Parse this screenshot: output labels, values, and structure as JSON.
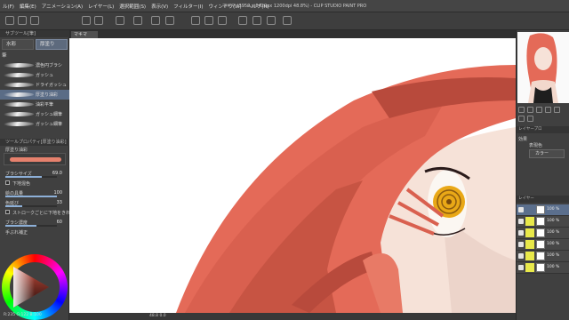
{
  "window": {
    "title": "マキマ (3950 x 6420px 1200dpi 48.8%) - CLIP STUDIO PAINT PRO",
    "menu": [
      "ル(F)",
      "編集(E)",
      "アニメーション(A)",
      "レイヤー(L)",
      "選択範囲(S)",
      "表示(V)",
      "フィルター(I)",
      "ウィンドウ(W)",
      "ヘルプ(H)"
    ]
  },
  "left_panel": {
    "sub_tool_header": "サブツール[筆]",
    "tabs": [
      "水彩",
      "厚塗り"
    ],
    "category": "筆",
    "brushes": [
      {
        "label": "濃色円ブラシ",
        "selected": false
      },
      {
        "label": "ガッシュ",
        "selected": false
      },
      {
        "label": "ドライガッシュ",
        "selected": false
      },
      {
        "label": "厚塗り油彩",
        "selected": true
      },
      {
        "label": "油彩平筆",
        "selected": false
      },
      {
        "label": "ガッシュ細筆",
        "selected": false
      },
      {
        "label": "ガッシュ細筆",
        "selected": false
      }
    ],
    "tool_property_header": "ツールプロパティ[厚塗り油彩]",
    "brush_preview_label": "厚塗り油彩",
    "properties": [
      {
        "label": "ブラシサイズ",
        "value": "69.0",
        "fill": 0.7,
        "type": "slider"
      },
      {
        "label": "下地混色",
        "value": "",
        "type": "check"
      },
      {
        "label": "絵の具量",
        "value": "100",
        "fill": 1.0,
        "type": "slider"
      },
      {
        "label": "色延び",
        "value": "33",
        "fill": 0.33,
        "type": "slider"
      },
      {
        "label": "ストロークごとに下地をきれいにする",
        "value": "",
        "type": "check"
      },
      {
        "label": "ブラシ濃度",
        "value": "60",
        "fill": 0.6,
        "type": "slider"
      },
      {
        "label": "手ぶれ補正",
        "value": "",
        "type": "text"
      }
    ],
    "color_readout": "R:235 G:122 B:100"
  },
  "canvas": {
    "tab_label": "マキマ",
    "status_text": "48.8   0.0"
  },
  "right_panel": {
    "tabs": "ナビゲーター",
    "layer_property_tab": "レイヤープロ",
    "effect_label": "効果",
    "expression_label": "表現色",
    "expression_value": "カラー",
    "layer_header": "レイヤー",
    "layers": [
      {
        "name": "100 %",
        "selected": true,
        "color_thumb": false
      },
      {
        "name": "100 %",
        "selected": false,
        "color_thumb": true
      },
      {
        "name": "100 %",
        "selected": false,
        "color_thumb": true
      },
      {
        "name": "100 %",
        "selected": false,
        "color_thumb": true
      },
      {
        "name": "100 %",
        "selected": false,
        "color_thumb": true
      },
      {
        "name": "100 %",
        "selected": false,
        "color_thumb": true
      }
    ]
  },
  "colors": {
    "hair": "#e46a58",
    "hair_shadow": "#b84a3c",
    "skin": "#f6e2d8",
    "eye_iris": "#e9a817",
    "accent_selected": "#5a6c86"
  }
}
